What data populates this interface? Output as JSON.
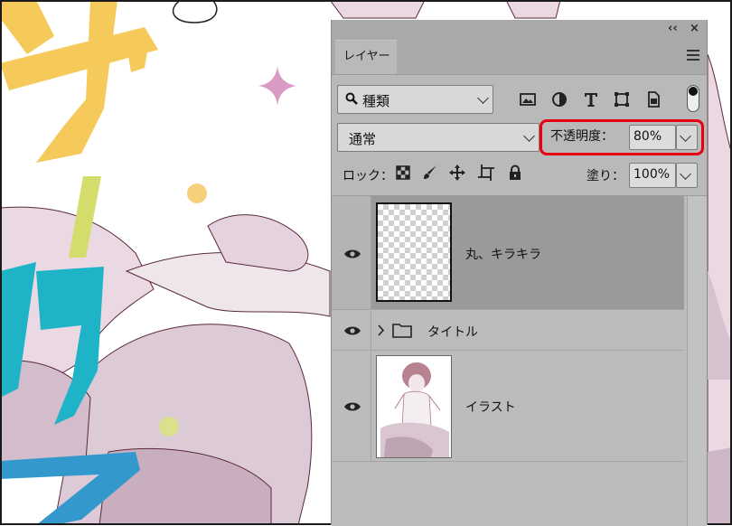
{
  "panel": {
    "collapse_glyph": "‹‹",
    "close_glyph": "×",
    "tab_label": "レイヤー",
    "menu_icon": "hamburger-menu-icon"
  },
  "filter": {
    "label": "種類",
    "icons": [
      "image-filter-icon",
      "adjustment-filter-icon",
      "type-filter-icon",
      "shape-filter-icon",
      "smart-object-filter-icon"
    ]
  },
  "blend": {
    "mode": "通常",
    "opacity_label": "不透明度：",
    "opacity_value": "80%",
    "highlight_color": "#e60012"
  },
  "lock": {
    "label": "ロック：",
    "icons": [
      "lock-transparent-pixels-icon",
      "lock-image-pixels-icon",
      "lock-position-icon",
      "lock-artboard-icon",
      "lock-all-icon"
    ],
    "fill_label": "塗り：",
    "fill_value": "100%"
  },
  "layers": [
    {
      "name": "丸、キラキラ",
      "type": "layer",
      "visible": true,
      "selected": true
    },
    {
      "name": "タイトル",
      "type": "group",
      "visible": true,
      "selected": false
    },
    {
      "name": "イラスト",
      "type": "layer",
      "visible": true,
      "selected": false
    }
  ],
  "colors": {
    "panel_bg": "#b9b9b9",
    "selected_row": "#9a9a9a",
    "accent_yellow": "#f5c95a",
    "accent_cyan": "#1fb3c8",
    "accent_blue": "#3399cc",
    "accent_lime": "#d4dc6c",
    "accent_pink": "#d99bc4"
  }
}
